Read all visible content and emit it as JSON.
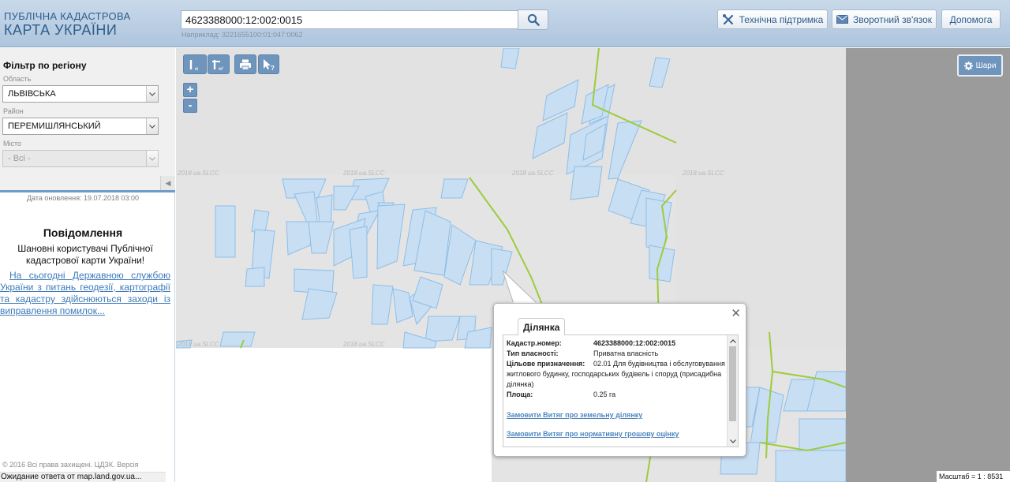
{
  "header": {
    "logo_line1": "ПУБЛІЧНА КАДАСТРОВА",
    "logo_line2": "КАРТА УКРАЇНИ",
    "search_value": "4623388000:12:002:0015",
    "search_hint": "Наприклад: 3221655100:01:047:0062",
    "support_label": "Технічна підтримка",
    "feedback_label": "Зворотний зв'язок",
    "help_label": "Допомога"
  },
  "sidebar": {
    "filter_title": "Фільтр по регіону",
    "region_label": "Область",
    "region_value": "ЛЬВІВСЬКА",
    "district_label": "Район",
    "district_value": "ПЕРЕМИШЛЯНСЬКИЙ",
    "city_label": "Місто",
    "city_value": "- Всі -",
    "update_date": "Дата оновлення: 19.07.2018 03:00",
    "notice_title": "Повідомлення",
    "notice_greeting": "Шановні користувачі Публічної кадастрової карти України!",
    "notice_link": "На сьогодні Державною службою України з питань геодезії, картографії та кадастру здійснюються заходи із виправлення помилок...",
    "copyright": "© 2016 Всі права захищені. ЦДЗК. Версія",
    "status": "Ожидание ответа от map.land.gov.ua..."
  },
  "map": {
    "watermark": "2018 ua.SLCC",
    "zoom_in": "+",
    "zoom_out": "-",
    "layers_label": "Шари",
    "scale_text": "Масштаб = 1 : 8531",
    "tools": [
      "measure-length-icon",
      "measure-area-icon",
      "print-icon",
      "identify-icon"
    ]
  },
  "popup": {
    "tab_label": "Ділянка",
    "cadastral_number_key": "Кадастр.номер:",
    "cadastral_number_value": "4623388000:12:002:0015",
    "ownership_key": "Тип власності:",
    "ownership_value": "Приватна власність",
    "purpose_key": "Цільове призначення:",
    "purpose_value": "02.01 Для будівництва і обслуговування житлового будинку, господарських будівель і споруд (присадибна ділянка)",
    "area_key": "Площа:",
    "area_value": "0.25 га",
    "link_extract": "Замовити Витяг про земельну ділянку",
    "link_valuation": "Замовити Витяг про нормативну грошову оцінку"
  },
  "colors": {
    "header_bg": "#b9cde2",
    "accent": "#6f95bd",
    "parcel_fill": "#c8def2",
    "parcel_stroke": "#8ebee8",
    "boundary_line": "#9ccc3c",
    "map_bg": "#e3e3e3"
  }
}
